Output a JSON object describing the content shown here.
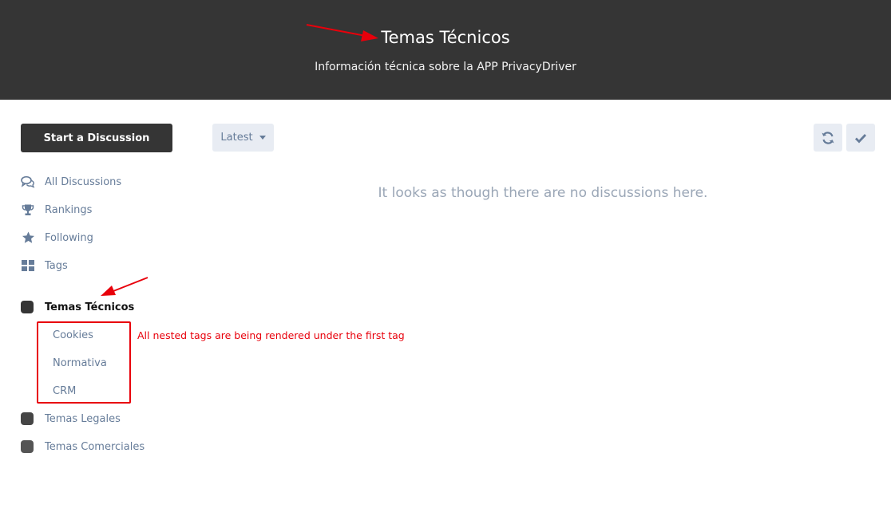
{
  "hero": {
    "title": "Temas Técnicos",
    "subtitle": "Información técnica sobre la APP PrivacyDriver",
    "background": "#353535"
  },
  "toolbar": {
    "start_label": "Start a Discussion",
    "sort_label": "Latest",
    "refresh_icon": "refresh-icon",
    "mark_read_icon": "check-icon"
  },
  "nav": {
    "items": [
      {
        "label": "All Discussions",
        "icon": "comments-icon"
      },
      {
        "label": "Rankings",
        "icon": "trophy-icon"
      },
      {
        "label": "Following",
        "icon": "star-icon"
      },
      {
        "label": "Tags",
        "icon": "grid-icon"
      }
    ]
  },
  "tags": {
    "primary": [
      {
        "label": "Temas Técnicos",
        "color": "#353535",
        "active": true
      },
      {
        "label": "Temas Legales",
        "color": "#454545"
      },
      {
        "label": "Temas Comerciales",
        "color": "#555555"
      }
    ],
    "children": [
      {
        "label": "Cookies"
      },
      {
        "label": "Normativa"
      },
      {
        "label": "CRM"
      }
    ]
  },
  "main": {
    "empty_message": "It looks as though there are no discussions here."
  },
  "annotation": {
    "text": "All nested tags are being rendered under the first tag",
    "color": "#e8000b"
  }
}
